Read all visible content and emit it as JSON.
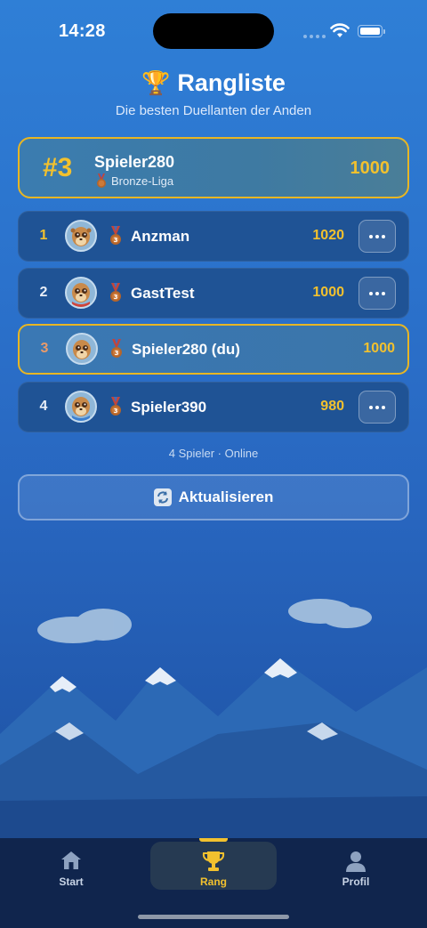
{
  "status": {
    "time": "14:28"
  },
  "header": {
    "title": "Rangliste",
    "subtitle": "Die besten Duellanten der Anden"
  },
  "my_card": {
    "rank": "#3",
    "name": "Spieler280",
    "league": "Bronze-Liga",
    "score": "1000"
  },
  "leaderboard": [
    {
      "rank": "1",
      "name": "Anzman",
      "score": "1020",
      "is_me": false
    },
    {
      "rank": "2",
      "name": "GastTest",
      "score": "1000",
      "is_me": false
    },
    {
      "rank": "3",
      "name": "Spieler280 (du)",
      "score": "1000",
      "is_me": true
    },
    {
      "rank": "4",
      "name": "Spieler390",
      "score": "980",
      "is_me": false
    }
  ],
  "footer_info": "4 Spieler · Online",
  "refresh_label": "Aktualisieren",
  "tabs": [
    {
      "label": "Start",
      "icon": "home-icon",
      "active": false
    },
    {
      "label": "Rang",
      "icon": "trophy-icon",
      "active": true
    },
    {
      "label": "Profil",
      "icon": "person-icon",
      "active": false
    }
  ],
  "colors": {
    "accent": "#f2c12e",
    "bronze": "#b5652a",
    "tab_bar": "#10254d",
    "background_top": "#2f7fd6",
    "background_bottom": "#1d4f9c"
  }
}
